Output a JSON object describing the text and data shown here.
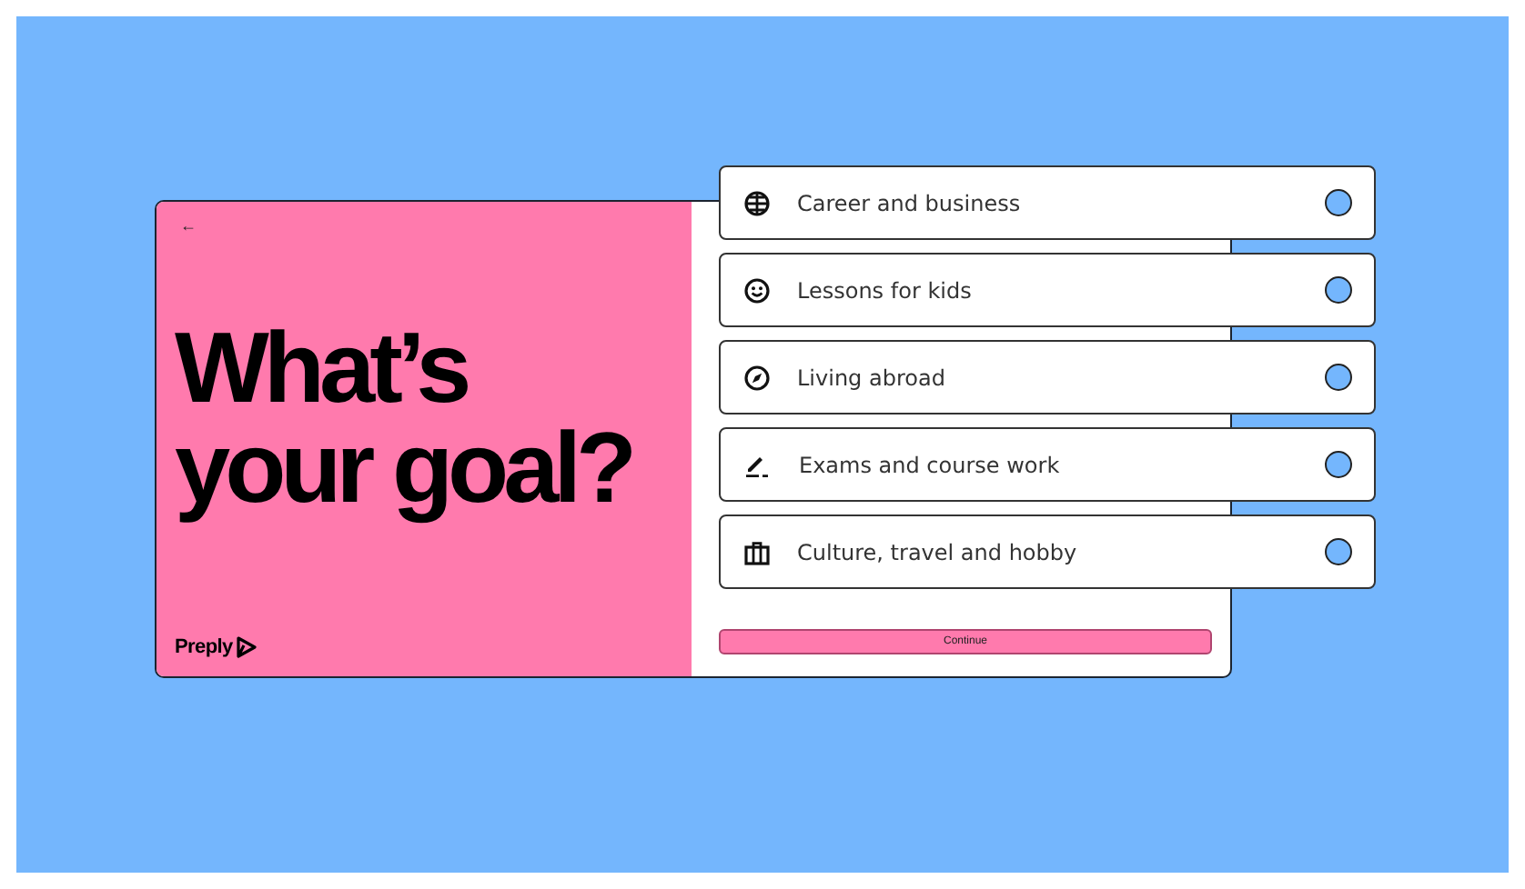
{
  "back_button": "←",
  "heading": "What’s your goal?",
  "logo": {
    "text": "Preply"
  },
  "options": [
    {
      "label": "Career and business",
      "selected": false
    },
    {
      "label": "Lessons for kids",
      "selected": false
    },
    {
      "label": "Living abroad",
      "selected": false
    },
    {
      "label": "Exams and course work",
      "selected": false
    },
    {
      "label": "Culture, travel and hobby",
      "selected": false
    }
  ],
  "continue_button": "Continue"
}
